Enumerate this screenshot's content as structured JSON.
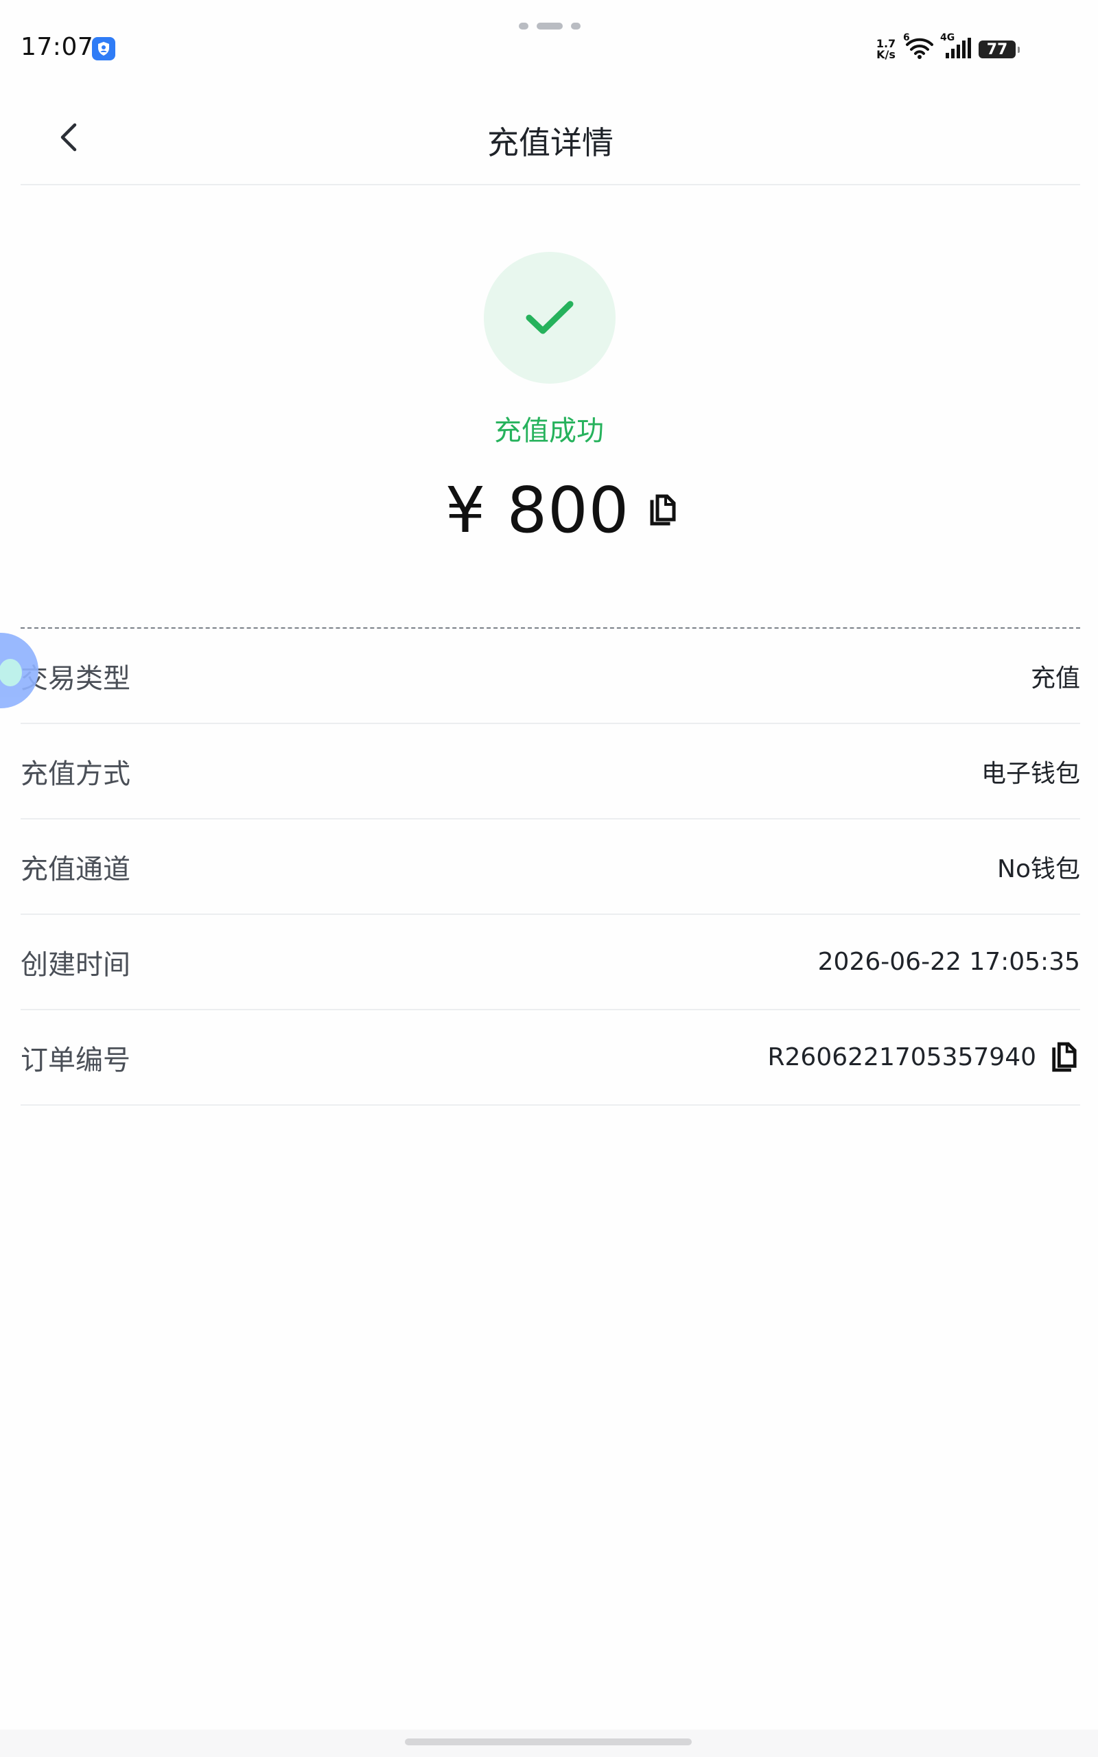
{
  "status_bar": {
    "time": "17:07",
    "speed_value": "1.7",
    "speed_unit": "K/s",
    "wifi_label": "6",
    "network_type": "4G",
    "battery": "77",
    "icons": [
      "security-badge-icon",
      "wifi-icon",
      "signal-icon",
      "battery-icon"
    ]
  },
  "header": {
    "title": "充值详情",
    "back_icon": "chevron-left-icon"
  },
  "result": {
    "status_text": "充值成功",
    "amount": "¥ 800",
    "status_icon": "checkmark-icon",
    "copy_icon": "copy-icon"
  },
  "details": [
    {
      "label": "交易类型",
      "value": "充值"
    },
    {
      "label": "充值方式",
      "value": "电子钱包"
    },
    {
      "label": "充值通道",
      "value": "No钱包"
    },
    {
      "label": "创建时间",
      "value": "2026-06-22 17:05:35"
    },
    {
      "label": "订单编号",
      "value": "R2606221705357940",
      "copyable": true
    }
  ],
  "colors": {
    "success_green": "#26b25c",
    "success_bg": "#e8f7ee",
    "title_text": "#1f2329",
    "label_text": "#4a4f57",
    "divider": "#eceef0",
    "floating_assistant": "#8fb2ff"
  }
}
